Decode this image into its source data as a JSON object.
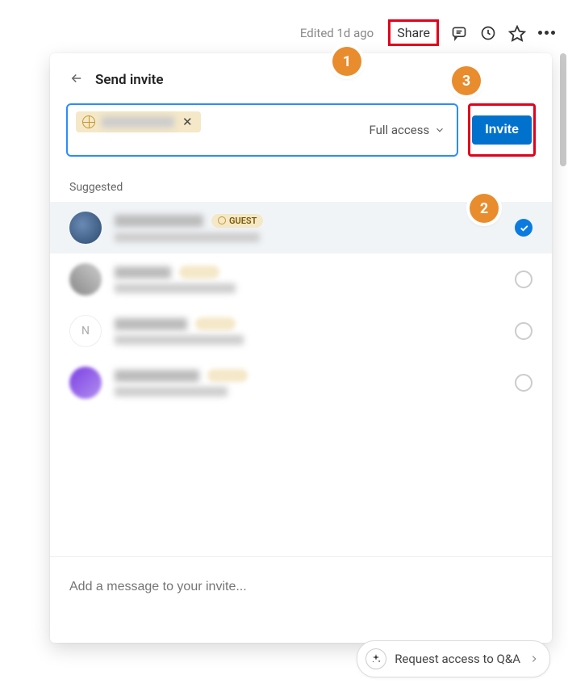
{
  "topbar": {
    "edited": "Edited 1d ago",
    "share": "Share"
  },
  "modal": {
    "title": "Send invite",
    "chip_name": "redacted",
    "access_label": "Full access",
    "invite_btn": "Invite",
    "suggested_label": "Suggested",
    "message_placeholder": "Add a message to your invite...",
    "guest_badge": "GUEST"
  },
  "suggested": [
    {
      "selected": true,
      "guest": true
    },
    {
      "selected": false,
      "guest": false
    },
    {
      "selected": false,
      "guest": false
    },
    {
      "selected": false,
      "guest": false
    }
  ],
  "callouts": {
    "c1": "1",
    "c2": "2",
    "c3": "3"
  },
  "footer_widget": {
    "label": "Request access to Q&A"
  }
}
